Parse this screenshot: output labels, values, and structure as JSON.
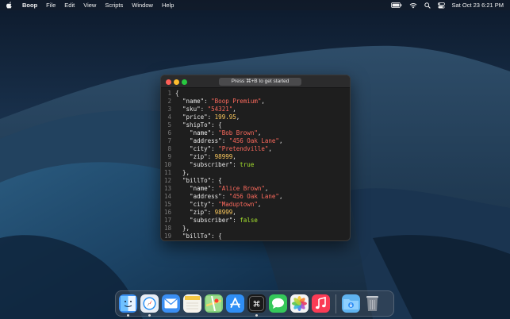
{
  "menubar": {
    "app_name": "Boop",
    "menus": [
      "File",
      "Edit",
      "View",
      "Scripts",
      "Window",
      "Help"
    ],
    "clock": "Sat Oct 23  6:21 PM"
  },
  "window": {
    "hint": "Press ⌘+B to get started"
  },
  "editor": {
    "lines": [
      [
        {
          "t": "{",
          "c": "punc"
        }
      ],
      [
        {
          "t": "  \"name\"",
          "c": "key"
        },
        {
          "t": ": ",
          "c": "punc"
        },
        {
          "t": "\"Boop Premium\"",
          "c": "str"
        },
        {
          "t": ",",
          "c": "punc"
        }
      ],
      [
        {
          "t": "  \"sku\"",
          "c": "key"
        },
        {
          "t": ": ",
          "c": "punc"
        },
        {
          "t": "\"54321\"",
          "c": "str"
        },
        {
          "t": ",",
          "c": "punc"
        }
      ],
      [
        {
          "t": "  \"price\"",
          "c": "key"
        },
        {
          "t": ": ",
          "c": "punc"
        },
        {
          "t": "199.95",
          "c": "num"
        },
        {
          "t": ",",
          "c": "punc"
        }
      ],
      [
        {
          "t": "  \"shipTo\"",
          "c": "key"
        },
        {
          "t": ": {",
          "c": "punc"
        }
      ],
      [
        {
          "t": "    \"name\"",
          "c": "key"
        },
        {
          "t": ": ",
          "c": "punc"
        },
        {
          "t": "\"Bob Brown\"",
          "c": "str"
        },
        {
          "t": ",",
          "c": "punc"
        }
      ],
      [
        {
          "t": "    \"address\"",
          "c": "key"
        },
        {
          "t": ": ",
          "c": "punc"
        },
        {
          "t": "\"456 Oak Lane\"",
          "c": "str"
        },
        {
          "t": ",",
          "c": "punc"
        }
      ],
      [
        {
          "t": "    \"city\"",
          "c": "key"
        },
        {
          "t": ": ",
          "c": "punc"
        },
        {
          "t": "\"Pretendville\"",
          "c": "str"
        },
        {
          "t": ",",
          "c": "punc"
        }
      ],
      [
        {
          "t": "    \"zip\"",
          "c": "key"
        },
        {
          "t": ": ",
          "c": "punc"
        },
        {
          "t": "98999",
          "c": "num"
        },
        {
          "t": ",",
          "c": "punc"
        }
      ],
      [
        {
          "t": "    \"subscriber\"",
          "c": "key"
        },
        {
          "t": ": ",
          "c": "punc"
        },
        {
          "t": "true",
          "c": "bool"
        }
      ],
      [
        {
          "t": "  },",
          "c": "punc"
        }
      ],
      [
        {
          "t": "  \"billTo\"",
          "c": "key"
        },
        {
          "t": ": {",
          "c": "punc"
        }
      ],
      [
        {
          "t": "    \"name\"",
          "c": "key"
        },
        {
          "t": ": ",
          "c": "punc"
        },
        {
          "t": "\"Alice Brown\"",
          "c": "str"
        },
        {
          "t": ",",
          "c": "punc"
        }
      ],
      [
        {
          "t": "    \"address\"",
          "c": "key"
        },
        {
          "t": ": ",
          "c": "punc"
        },
        {
          "t": "\"456 Oak Lane\"",
          "c": "str"
        },
        {
          "t": ",",
          "c": "punc"
        }
      ],
      [
        {
          "t": "    \"city\"",
          "c": "key"
        },
        {
          "t": ": ",
          "c": "punc"
        },
        {
          "t": "\"Maduptown\"",
          "c": "str"
        },
        {
          "t": ",",
          "c": "punc"
        }
      ],
      [
        {
          "t": "    \"zip\"",
          "c": "key"
        },
        {
          "t": ": ",
          "c": "punc"
        },
        {
          "t": "98999",
          "c": "num"
        },
        {
          "t": ",",
          "c": "punc"
        }
      ],
      [
        {
          "t": "    \"subscriber\"",
          "c": "key"
        },
        {
          "t": ": ",
          "c": "punc"
        },
        {
          "t": "false",
          "c": "bool"
        }
      ],
      [
        {
          "t": "  },",
          "c": "punc"
        }
      ],
      [
        {
          "t": "  \"billTo\"",
          "c": "key"
        },
        {
          "t": ": {",
          "c": "punc"
        }
      ]
    ]
  },
  "dock": {
    "apps": [
      {
        "name": "finder-icon",
        "bg": "#3b8ff0",
        "running": true
      },
      {
        "name": "safari-icon",
        "bg": "#e9eef5",
        "running": true
      },
      {
        "name": "mail-icon",
        "bg": "#3a8ef3",
        "running": false
      },
      {
        "name": "notes-icon",
        "bg": "#f5f3ec",
        "running": false
      },
      {
        "name": "maps-icon",
        "bg": "#7fcf7a",
        "running": false
      },
      {
        "name": "app-store-icon",
        "bg": "#2f8ef5",
        "running": false
      },
      {
        "name": "boop-icon",
        "bg": "#1a1a1a",
        "running": true
      },
      {
        "name": "messages-icon",
        "bg": "#35c85a",
        "running": false
      },
      {
        "name": "photos-icon",
        "bg": "#f4f4f4",
        "running": false
      },
      {
        "name": "music-icon",
        "bg": "#fa3b55",
        "running": false
      }
    ],
    "extras": [
      {
        "name": "downloads-folder-icon",
        "bg": "#5fb3f0",
        "running": false
      },
      {
        "name": "trash-icon",
        "bg": "transparent",
        "running": false
      }
    ]
  },
  "colors": {
    "string": "#fc6a5d",
    "number": "#fcc95e",
    "boolean": "#a6e22e",
    "text": "#e8e8e8"
  }
}
